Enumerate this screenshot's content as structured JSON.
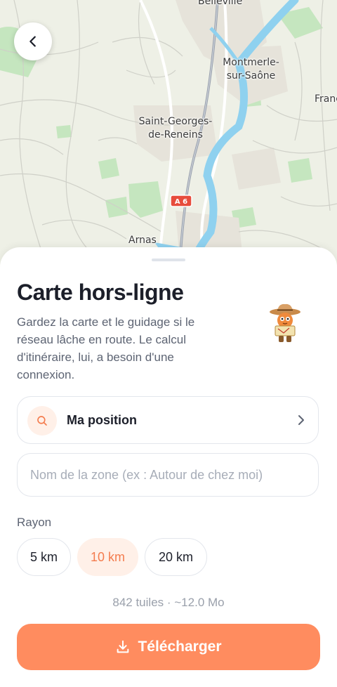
{
  "map": {
    "labels": {
      "belleville": "Belleville",
      "montmerle": "Montmerle-\nsur-Saône",
      "france": "Franc",
      "saint_georges": "Saint-Georges-\nde-Reneins",
      "arnas": "Arnas"
    },
    "road_shield": "A 6",
    "colors": {
      "land": "#eef0e6",
      "water": "#8fd1ef",
      "park": "#c5e6bf",
      "road_shield": "#e74c3c"
    }
  },
  "header": {
    "back_icon": "chevron-left-icon"
  },
  "sheet": {
    "title": "Carte hors-ligne",
    "description": "Gardez la carte et le guidage si le réseau lâche en route. Le calcul d'itinéraire, lui, a besoin d'une connexion.",
    "mascot_icon": "cowboy-mascot-icon",
    "position": {
      "label": "Ma position",
      "icon": "search-icon"
    },
    "zone": {
      "value": "",
      "placeholder": "Nom de la zone (ex : Autour de chez moi)"
    },
    "radius": {
      "label": "Rayon",
      "options": [
        "5 km",
        "10 km",
        "20 km"
      ],
      "selected": "10 km"
    },
    "stats": "842 tuiles · ~12.0 Mo",
    "download_label": "Télécharger",
    "colors": {
      "accent": "#ff8c5f",
      "accent_text": "#f47c4e",
      "accent_soft": "#fff0e8"
    }
  }
}
